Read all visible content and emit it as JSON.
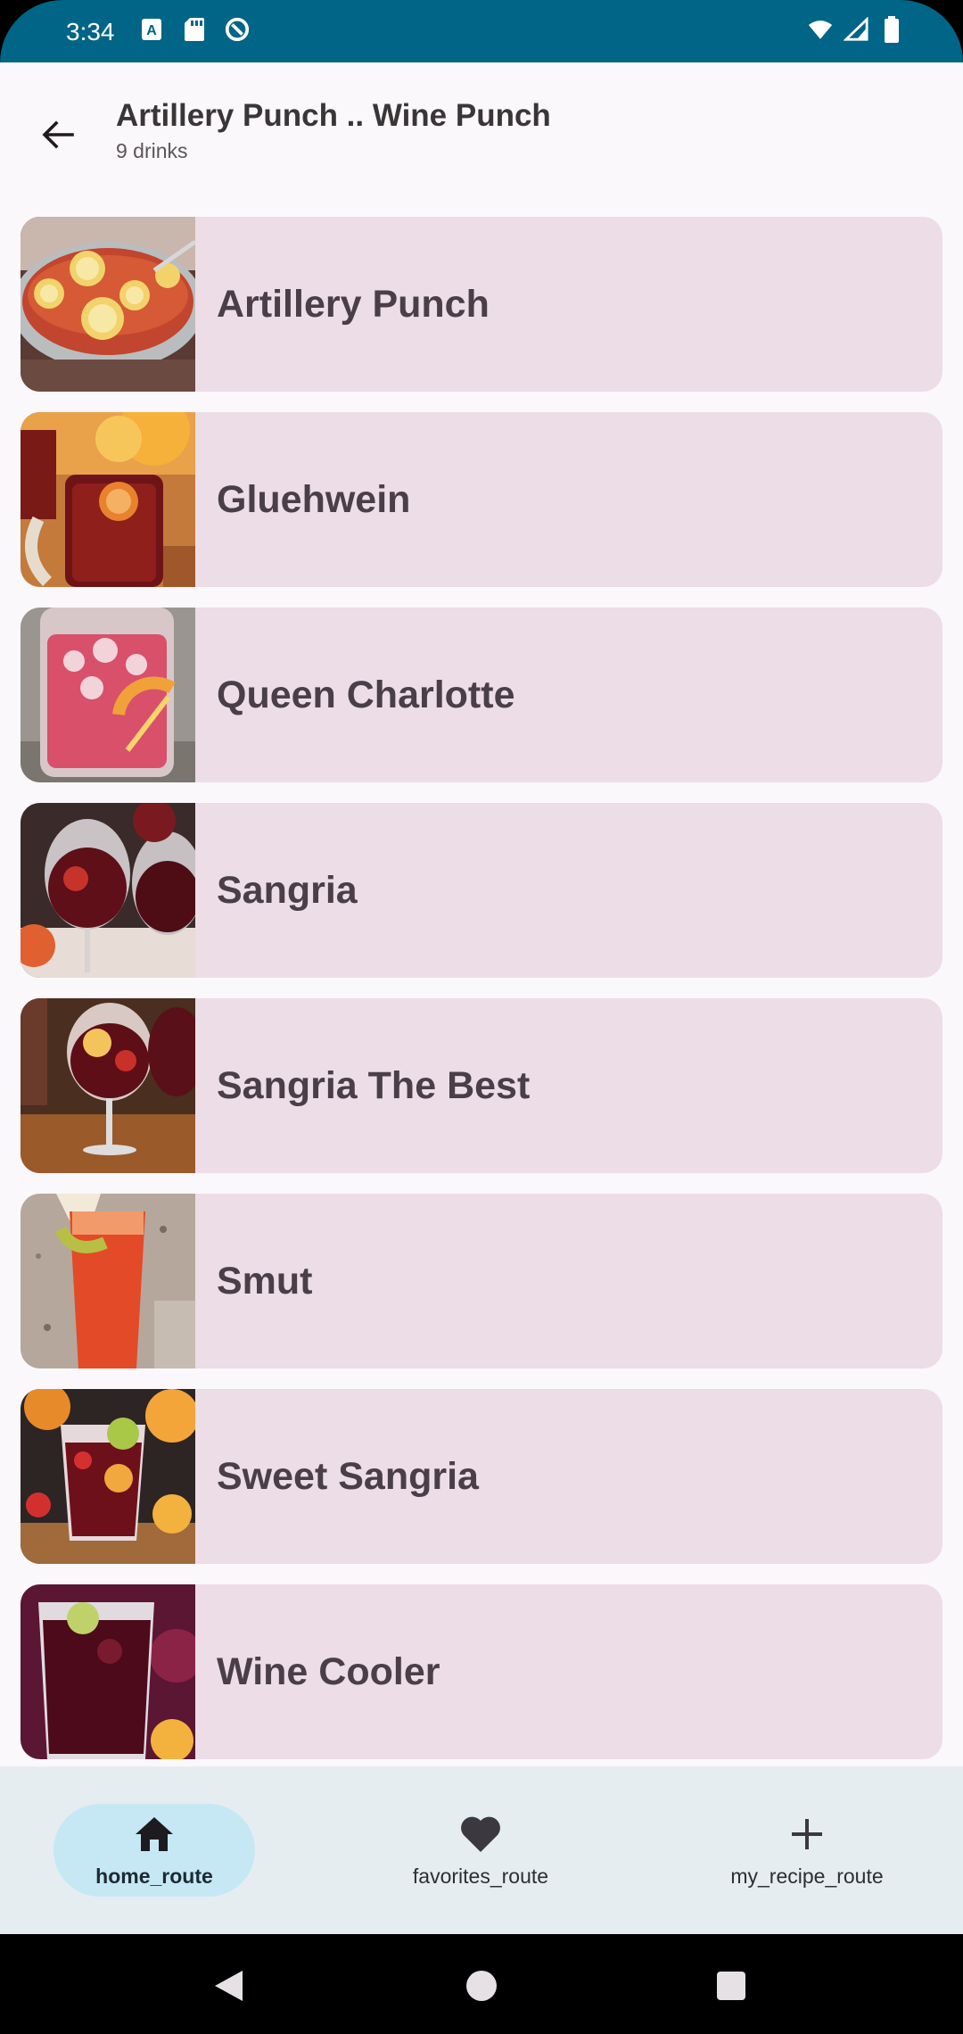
{
  "status_bar": {
    "time": "3:34",
    "left_icons": [
      "font-icon",
      "sd-card-icon",
      "at-sign-icon"
    ],
    "right_icons": [
      "wifi-icon",
      "signal-icon",
      "battery-icon"
    ],
    "background": "#006586"
  },
  "top_bar": {
    "title": "Artillery Punch .. Wine Punch",
    "subtitle": "9 drinks",
    "back_icon": "arrow-left-icon"
  },
  "drinks": [
    {
      "name": "Artillery Punch"
    },
    {
      "name": "Gluehwein"
    },
    {
      "name": "Queen Charlotte"
    },
    {
      "name": "Sangria"
    },
    {
      "name": "Sangria The  Best"
    },
    {
      "name": "Smut"
    },
    {
      "name": "Sweet Sangria"
    },
    {
      "name": "Wine Cooler"
    }
  ],
  "bottom_nav": {
    "items": [
      {
        "label": "home_route",
        "icon": "home-icon",
        "active": true
      },
      {
        "label": "favorites_route",
        "icon": "heart-icon",
        "active": false
      },
      {
        "label": "my_recipe_route",
        "icon": "plus-icon",
        "active": false
      }
    ]
  },
  "colors": {
    "card": "#eddde6",
    "nav_background": "#e5edf0",
    "active_pill": "#c5e8f4"
  }
}
